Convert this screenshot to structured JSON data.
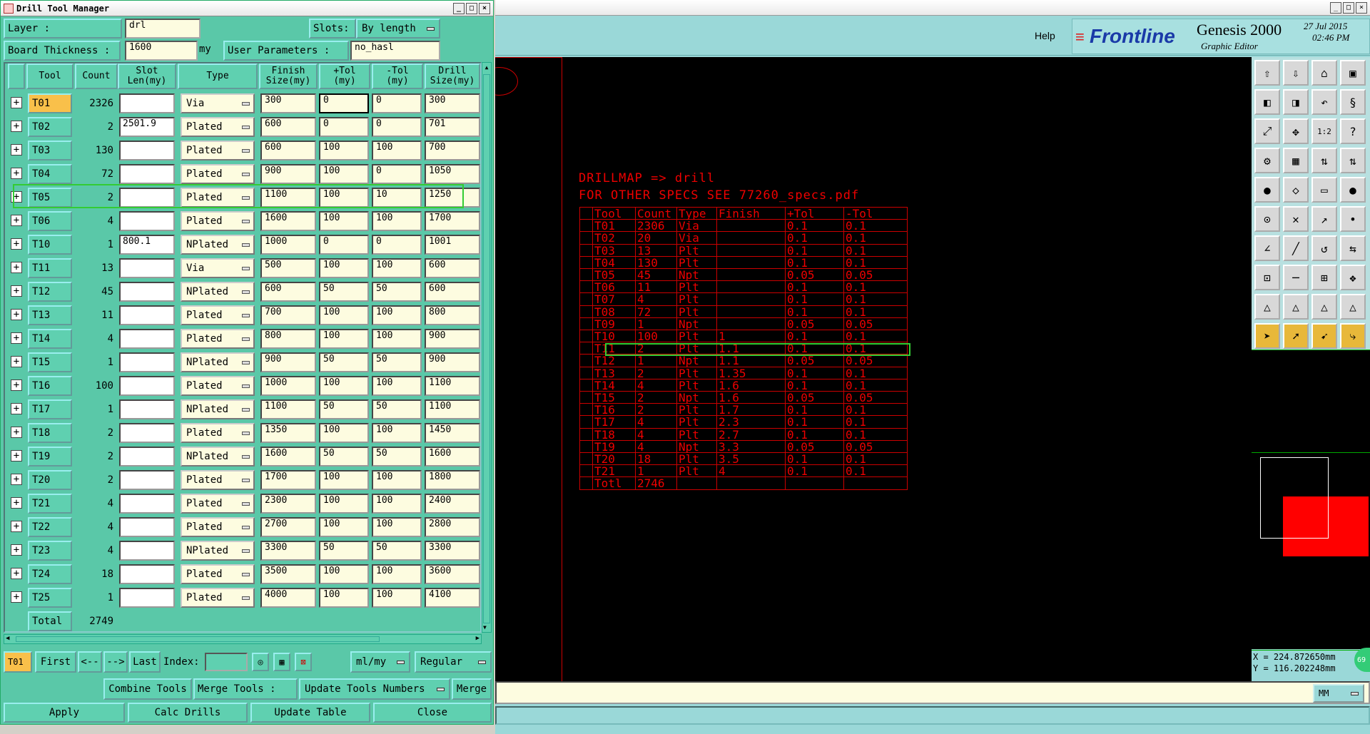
{
  "dtm": {
    "title": "Drill Tool Manager",
    "layer_label": "Layer            :",
    "layer_value": "drl",
    "slots_label": "Slots:",
    "slots_value": "By length",
    "board_label": "Board Thickness :",
    "board_value": "1600",
    "board_unit": "my",
    "userparams_label": "User Parameters :",
    "userparams_value": "no_hasl",
    "headers": [
      "Tool",
      "Count",
      "Slot\nLen(my)",
      "Type",
      "Finish\nSize(my)",
      "+Tol\n(my)",
      "-Tol\n(my)",
      "Drill\nSize(my)"
    ],
    "rows": [
      {
        "tool": "T01",
        "count": "2326",
        "slot": "",
        "type": "Via",
        "finish": "300",
        "ptol": "0",
        "mtol": "0",
        "drill": "300"
      },
      {
        "tool": "T02",
        "count": "2",
        "slot": "2501.9",
        "type": "Plated",
        "finish": "600",
        "ptol": "0",
        "mtol": "0",
        "drill": "701"
      },
      {
        "tool": "T03",
        "count": "130",
        "slot": "",
        "type": "Plated",
        "finish": "600",
        "ptol": "100",
        "mtol": "100",
        "drill": "700"
      },
      {
        "tool": "T04",
        "count": "72",
        "slot": "",
        "type": "Plated",
        "finish": "900",
        "ptol": "100",
        "mtol": "0",
        "drill": "1050"
      },
      {
        "tool": "T05",
        "count": "2",
        "slot": "",
        "type": "Plated",
        "finish": "1100",
        "ptol": "100",
        "mtol": "10",
        "drill": "1250"
      },
      {
        "tool": "T06",
        "count": "4",
        "slot": "",
        "type": "Plated",
        "finish": "1600",
        "ptol": "100",
        "mtol": "100",
        "drill": "1700"
      },
      {
        "tool": "T10",
        "count": "1",
        "slot": "800.1",
        "type": "NPlated",
        "finish": "1000",
        "ptol": "0",
        "mtol": "0",
        "drill": "1001"
      },
      {
        "tool": "T11",
        "count": "13",
        "slot": "",
        "type": "Via",
        "finish": "500",
        "ptol": "100",
        "mtol": "100",
        "drill": "600"
      },
      {
        "tool": "T12",
        "count": "45",
        "slot": "",
        "type": "NPlated",
        "finish": "600",
        "ptol": "50",
        "mtol": "50",
        "drill": "600"
      },
      {
        "tool": "T13",
        "count": "11",
        "slot": "",
        "type": "Plated",
        "finish": "700",
        "ptol": "100",
        "mtol": "100",
        "drill": "800"
      },
      {
        "tool": "T14",
        "count": "4",
        "slot": "",
        "type": "Plated",
        "finish": "800",
        "ptol": "100",
        "mtol": "100",
        "drill": "900"
      },
      {
        "tool": "T15",
        "count": "1",
        "slot": "",
        "type": "NPlated",
        "finish": "900",
        "ptol": "50",
        "mtol": "50",
        "drill": "900"
      },
      {
        "tool": "T16",
        "count": "100",
        "slot": "",
        "type": "Plated",
        "finish": "1000",
        "ptol": "100",
        "mtol": "100",
        "drill": "1100"
      },
      {
        "tool": "T17",
        "count": "1",
        "slot": "",
        "type": "NPlated",
        "finish": "1100",
        "ptol": "50",
        "mtol": "50",
        "drill": "1100"
      },
      {
        "tool": "T18",
        "count": "2",
        "slot": "",
        "type": "Plated",
        "finish": "1350",
        "ptol": "100",
        "mtol": "100",
        "drill": "1450"
      },
      {
        "tool": "T19",
        "count": "2",
        "slot": "",
        "type": "NPlated",
        "finish": "1600",
        "ptol": "50",
        "mtol": "50",
        "drill": "1600"
      },
      {
        "tool": "T20",
        "count": "2",
        "slot": "",
        "type": "Plated",
        "finish": "1700",
        "ptol": "100",
        "mtol": "100",
        "drill": "1800"
      },
      {
        "tool": "T21",
        "count": "4",
        "slot": "",
        "type": "Plated",
        "finish": "2300",
        "ptol": "100",
        "mtol": "100",
        "drill": "2400"
      },
      {
        "tool": "T22",
        "count": "4",
        "slot": "",
        "type": "Plated",
        "finish": "2700",
        "ptol": "100",
        "mtol": "100",
        "drill": "2800"
      },
      {
        "tool": "T23",
        "count": "4",
        "slot": "",
        "type": "NPlated",
        "finish": "3300",
        "ptol": "50",
        "mtol": "50",
        "drill": "3300"
      },
      {
        "tool": "T24",
        "count": "18",
        "slot": "",
        "type": "Plated",
        "finish": "3500",
        "ptol": "100",
        "mtol": "100",
        "drill": "3600"
      },
      {
        "tool": "T25",
        "count": "1",
        "slot": "",
        "type": "Plated",
        "finish": "4000",
        "ptol": "100",
        "mtol": "100",
        "drill": "4100"
      }
    ],
    "total_label": "Total",
    "total_value": "2749",
    "nav": {
      "current": "T01",
      "first": "First",
      "prev": "<--",
      "next": "-->",
      "last": "Last",
      "index_label": "Index:",
      "units": "ml/my",
      "mode": "Regular"
    },
    "actions": {
      "combine": "Combine Tools",
      "merge_label": "Merge Tools :",
      "update_numbers": "Update Tools Numbers",
      "merge": "Merge"
    },
    "bottom": {
      "apply": "Apply",
      "calc": "Calc Drills",
      "update": "Update Table",
      "close": "Close"
    }
  },
  "genesis": {
    "help": "Help",
    "brand": "Frontline",
    "product": "Genesis 2000",
    "subtitle": "Graphic Editor",
    "date": "27 Jul 2015",
    "time": "02:46 PM",
    "coord_x": "X = 224.872650mm",
    "coord_y": "Y = 116.202248mm",
    "units": "MM",
    "drillmap_title": "DRILLMAP => drill",
    "drillmap_sub": "FOR OTHER SPECS SEE 77260_specs.pdf",
    "map_headers": [
      "Tool",
      "Count",
      "Type",
      "Finish",
      "+Tol",
      "-Tol"
    ],
    "map_rows": [
      [
        "T01",
        "2306",
        "Via",
        "",
        "0.1",
        "0.1"
      ],
      [
        "T02",
        "20",
        "Via",
        "",
        "0.1",
        "0.1"
      ],
      [
        "T03",
        "13",
        "Plt",
        "",
        "0.1",
        "0.1"
      ],
      [
        "T04",
        "130",
        "Plt",
        "",
        "0.1",
        "0.1"
      ],
      [
        "T05",
        "45",
        "Npt",
        "",
        "0.05",
        "0.05"
      ],
      [
        "T06",
        "11",
        "Plt",
        "",
        "0.1",
        "0.1"
      ],
      [
        "T07",
        "4",
        "Plt",
        "",
        "0.1",
        "0.1"
      ],
      [
        "T08",
        "72",
        "Plt",
        "",
        "0.1",
        "0.1"
      ],
      [
        "T09",
        "1",
        "Npt",
        "",
        "0.05",
        "0.05"
      ],
      [
        "T10",
        "100",
        "Plt",
        "1",
        "0.1",
        "0.1"
      ],
      [
        "T11",
        "2",
        "Plt",
        "1.1",
        "0.1",
        "0.1"
      ],
      [
        "T12",
        "1",
        "Npt",
        "1.1",
        "0.05",
        "0.05"
      ],
      [
        "T13",
        "2",
        "Plt",
        "1.35",
        "0.1",
        "0.1"
      ],
      [
        "T14",
        "4",
        "Plt",
        "1.6",
        "0.1",
        "0.1"
      ],
      [
        "T15",
        "2",
        "Npt",
        "1.6",
        "0.05",
        "0.05"
      ],
      [
        "T16",
        "2",
        "Plt",
        "1.7",
        "0.1",
        "0.1"
      ],
      [
        "T17",
        "4",
        "Plt",
        "2.3",
        "0.1",
        "0.1"
      ],
      [
        "T18",
        "4",
        "Plt",
        "2.7",
        "0.1",
        "0.1"
      ],
      [
        "T19",
        "4",
        "Npt",
        "3.3",
        "0.05",
        "0.05"
      ],
      [
        "T20",
        "18",
        "Plt",
        "3.5",
        "0.1",
        "0.1"
      ],
      [
        "T21",
        "1",
        "Plt",
        "4",
        "0.1",
        "0.1"
      ]
    ],
    "map_total": [
      "Totl",
      "2746"
    ]
  }
}
